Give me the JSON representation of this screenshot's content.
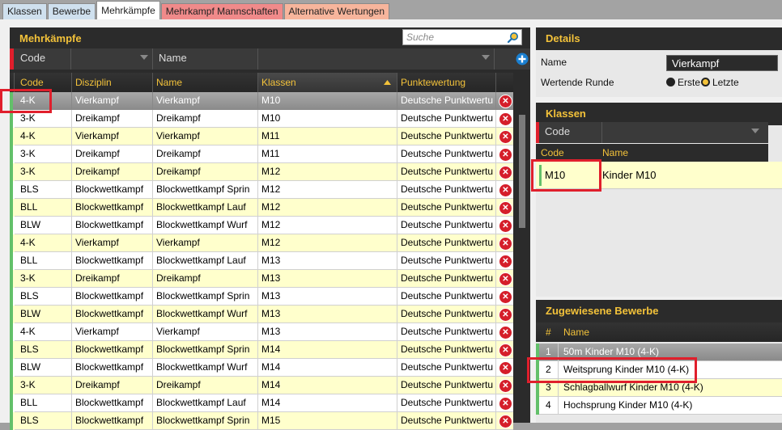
{
  "tabs": [
    {
      "label": "Klassen",
      "style": "blue"
    },
    {
      "label": "Bewerbe",
      "style": "blue"
    },
    {
      "label": "Mehrkämpfe",
      "style": "active"
    },
    {
      "label": "Mehrkampf Mannschaften",
      "style": "red"
    },
    {
      "label": "Alternative Wertungen",
      "style": "salmon"
    }
  ],
  "left": {
    "title": "Mehrkämpfe",
    "search_placeholder": "Suche",
    "filter": {
      "code_label": "Code",
      "name_label": "Name"
    },
    "columns": [
      "Code",
      "Disziplin",
      "Name",
      "Klassen",
      "Punktewertung"
    ],
    "sort_column": "Klassen",
    "rows": [
      {
        "code": "4-K",
        "disziplin": "Vierkampf",
        "name": "Vierkampf",
        "klassen": "M10",
        "punkte": "Deutsche Punktwertu",
        "selected": true
      },
      {
        "code": "3-K",
        "disziplin": "Dreikampf",
        "name": "Dreikampf",
        "klassen": "M10",
        "punkte": "Deutsche Punktwertu"
      },
      {
        "code": "4-K",
        "disziplin": "Vierkampf",
        "name": "Vierkampf",
        "klassen": "M11",
        "punkte": "Deutsche Punktwertu"
      },
      {
        "code": "3-K",
        "disziplin": "Dreikampf",
        "name": "Dreikampf",
        "klassen": "M11",
        "punkte": "Deutsche Punktwertu"
      },
      {
        "code": "3-K",
        "disziplin": "Dreikampf",
        "name": "Dreikampf",
        "klassen": "M12",
        "punkte": "Deutsche Punktwertu"
      },
      {
        "code": "BLS",
        "disziplin": "Blockwettkampf",
        "name": "Blockwettkampf Sprin",
        "klassen": "M12",
        "punkte": "Deutsche Punktwertu"
      },
      {
        "code": "BLL",
        "disziplin": "Blockwettkampf",
        "name": "Blockwettkampf Lauf",
        "klassen": "M12",
        "punkte": "Deutsche Punktwertu"
      },
      {
        "code": "BLW",
        "disziplin": "Blockwettkampf",
        "name": "Blockwettkampf Wurf",
        "klassen": "M12",
        "punkte": "Deutsche Punktwertu"
      },
      {
        "code": "4-K",
        "disziplin": "Vierkampf",
        "name": "Vierkampf",
        "klassen": "M12",
        "punkte": "Deutsche Punktwertu"
      },
      {
        "code": "BLL",
        "disziplin": "Blockwettkampf",
        "name": "Blockwettkampf Lauf",
        "klassen": "M13",
        "punkte": "Deutsche Punktwertu"
      },
      {
        "code": "3-K",
        "disziplin": "Dreikampf",
        "name": "Dreikampf",
        "klassen": "M13",
        "punkte": "Deutsche Punktwertu"
      },
      {
        "code": "BLS",
        "disziplin": "Blockwettkampf",
        "name": "Blockwettkampf Sprin",
        "klassen": "M13",
        "punkte": "Deutsche Punktwertu"
      },
      {
        "code": "BLW",
        "disziplin": "Blockwettkampf",
        "name": "Blockwettkampf Wurf",
        "klassen": "M13",
        "punkte": "Deutsche Punktwertu"
      },
      {
        "code": "4-K",
        "disziplin": "Vierkampf",
        "name": "Vierkampf",
        "klassen": "M13",
        "punkte": "Deutsche Punktwertu"
      },
      {
        "code": "BLS",
        "disziplin": "Blockwettkampf",
        "name": "Blockwettkampf Sprin",
        "klassen": "M14",
        "punkte": "Deutsche Punktwertu"
      },
      {
        "code": "BLW",
        "disziplin": "Blockwettkampf",
        "name": "Blockwettkampf Wurf",
        "klassen": "M14",
        "punkte": "Deutsche Punktwertu"
      },
      {
        "code": "3-K",
        "disziplin": "Dreikampf",
        "name": "Dreikampf",
        "klassen": "M14",
        "punkte": "Deutsche Punktwertu"
      },
      {
        "code": "BLL",
        "disziplin": "Blockwettkampf",
        "name": "Blockwettkampf Lauf",
        "klassen": "M14",
        "punkte": "Deutsche Punktwertu"
      },
      {
        "code": "BLS",
        "disziplin": "Blockwettkampf",
        "name": "Blockwettkampf Sprin",
        "klassen": "M15",
        "punkte": "Deutsche Punktwertu"
      }
    ]
  },
  "details": {
    "title": "Details",
    "name_label": "Name",
    "name_value": "Vierkampf",
    "runde_label": "Wertende Runde",
    "option_first": "Erste",
    "option_last": "Letzte",
    "selected_option": "Letzte"
  },
  "klassen": {
    "title": "Klassen",
    "filter_label": "Code",
    "col_code": "Code",
    "col_name": "Name",
    "rows": [
      {
        "code": "M10",
        "name": "Kinder M10"
      }
    ]
  },
  "bewerbe": {
    "title": "Zugewiesene Bewerbe",
    "col_num": "#",
    "col_name": "Name",
    "rows": [
      {
        "num": "1",
        "name": "50m Kinder M10 (4-K)",
        "selected": true
      },
      {
        "num": "2",
        "name": "Weitsprung Kinder M10 (4-K)"
      },
      {
        "num": "3",
        "name": "Schlagballwurf Kinder M10 (4-K)"
      },
      {
        "num": "4",
        "name": "Hochsprung Kinder M10 (4-K)"
      }
    ]
  },
  "colors": {
    "accent": "#f3c23a",
    "highlight": "#e01f2c",
    "row_yellow": "#ffffcc",
    "row_green_mark": "#63c06a"
  }
}
